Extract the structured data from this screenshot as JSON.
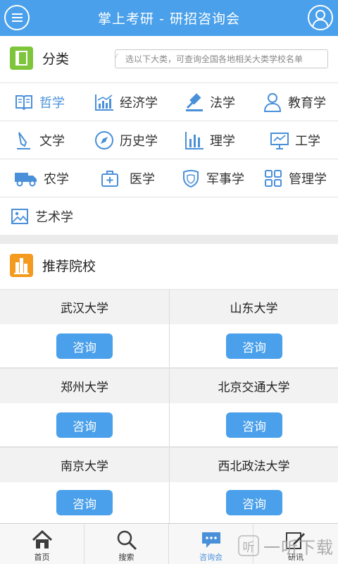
{
  "header": {
    "title": "掌上考研 - 研招咨询会",
    "menu_icon": "menu-icon",
    "user_icon": "user-icon"
  },
  "categories": {
    "title": "分类",
    "hint": "选以下大类，可查询全国各地相关大类学校名单",
    "active_color": "#4a90d9",
    "items": [
      {
        "label": "哲学",
        "icon": "book-icon",
        "active": true
      },
      {
        "label": "经济学",
        "icon": "bar-chart-icon"
      },
      {
        "label": "法学",
        "icon": "gavel-icon"
      },
      {
        "label": "教育学",
        "icon": "person-icon"
      },
      {
        "label": "文学",
        "icon": "pencil-icon"
      },
      {
        "label": "历史学",
        "icon": "compass-icon"
      },
      {
        "label": "理学",
        "icon": "lab-bars-icon"
      },
      {
        "label": "工学",
        "icon": "monitor-chart-icon"
      },
      {
        "label": "农学",
        "icon": "truck-icon"
      },
      {
        "label": "医学",
        "icon": "medical-kit-icon"
      },
      {
        "label": "军事学",
        "icon": "shield-icon"
      },
      {
        "label": "管理学",
        "icon": "grid-icon"
      },
      {
        "label": "艺术学",
        "icon": "picture-icon"
      }
    ]
  },
  "recommended": {
    "title": "推荐院校",
    "consult_label": "咨询",
    "schools": [
      "武汉大学",
      "山东大学",
      "郑州大学",
      "北京交通大学",
      "南京大学",
      "西北政法大学"
    ]
  },
  "tabbar": {
    "tabs": [
      {
        "label": "首页",
        "icon": "home-icon"
      },
      {
        "label": "搜索",
        "icon": "search-icon"
      },
      {
        "label": "咨询会",
        "icon": "chat-icon",
        "active": true
      },
      {
        "label": "研讯",
        "icon": "edit-icon"
      }
    ]
  },
  "watermark": {
    "logo": "听",
    "text": "一听下载"
  },
  "colors": {
    "brand_blue": "#4aa0ea",
    "category_green": "#7ec53b",
    "recommend_orange": "#f49a1f"
  }
}
